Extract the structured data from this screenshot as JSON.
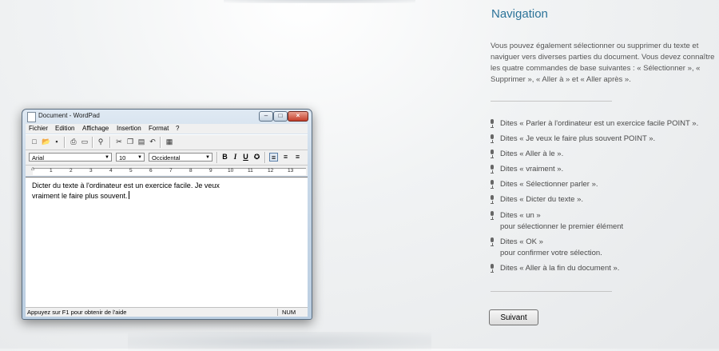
{
  "wordpad": {
    "title": "Document - WordPad",
    "menus": [
      "Fichier",
      "Edition",
      "Affichage",
      "Insertion",
      "Format",
      "?"
    ],
    "font_name": "Arial",
    "font_size": "10",
    "script": "Occidental",
    "ruler_numbers": [
      "1",
      "2",
      "3",
      "4",
      "5",
      "6",
      "7",
      "8",
      "9",
      "10",
      "11",
      "12",
      "13"
    ],
    "document_lines": [
      "Dicter du texte à l'ordinateur est un exercice facile.  Je veux",
      "vraiment le faire plus souvent."
    ],
    "status_help": "Appuyez sur F1 pour obtenir de l'aide",
    "status_num": "NUM"
  },
  "panel": {
    "heading": "Navigation",
    "intro": "Vous pouvez également sélectionner ou supprimer du texte et naviguer vers diverses parties du document.  Vous devez connaître les quatre commandes de base suivantes : « Sélectionner », « Supprimer », « Aller à » et « Aller après ».",
    "commands": [
      {
        "text": "Dites « Parler à l'ordinateur est un exercice facile POINT »."
      },
      {
        "text": "Dites « Je veux le faire plus souvent POINT »."
      },
      {
        "text": "Dites « Aller à le »."
      },
      {
        "text": "Dites « vraiment »."
      },
      {
        "text": "Dites « Sélectionner parler »."
      },
      {
        "text": "Dites « Dicter du texte »."
      },
      {
        "text": "Dites « un »",
        "sub": "pour sélectionner le premier élément"
      },
      {
        "text": "Dites « OK »",
        "sub": "pour confirmer votre sélection."
      },
      {
        "text": "Dites « Aller à la fin du document »."
      }
    ],
    "next_button": "Suivant"
  },
  "icons": {
    "toolbar": [
      "new-icon",
      "open-icon",
      "save-icon",
      "print-icon",
      "print-preview-icon",
      "find-icon",
      "cut-icon",
      "copy-icon",
      "paste-icon",
      "undo-icon",
      "insert-date-icon"
    ],
    "format": [
      "bold-icon",
      "italic-icon",
      "underline-icon",
      "color-icon",
      "align-left-icon",
      "align-center-icon",
      "align-right-icon"
    ],
    "command": "microphone-icon"
  }
}
